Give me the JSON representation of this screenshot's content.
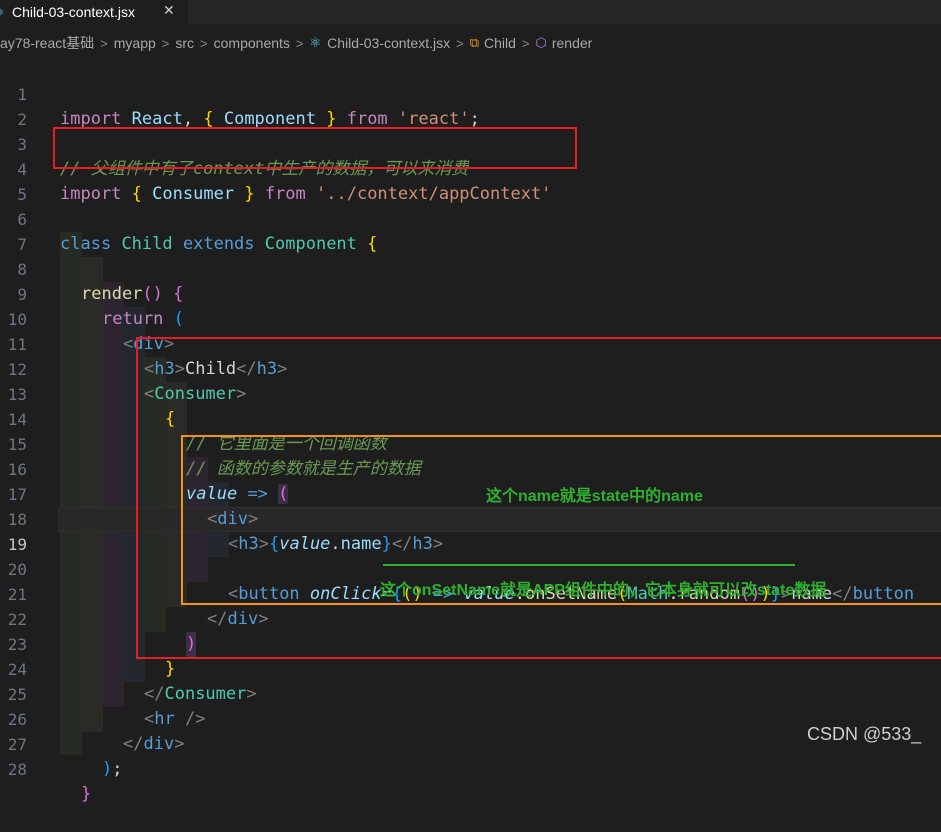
{
  "tab": {
    "icon": "react-icon",
    "title": "Child-03-context.jsx",
    "close": "✕"
  },
  "breadcrumb": {
    "items": [
      "ay78-react基础",
      "myapp",
      "src",
      "components"
    ],
    "file": "Child-03-context.jsx",
    "class_name": "Child",
    "method_name": "render"
  },
  "editor": {
    "line_numbers": [
      "1",
      "2",
      "3",
      "4",
      "5",
      "6",
      "7",
      "8",
      "9",
      "10",
      "11",
      "12",
      "13",
      "14",
      "15",
      "16",
      "17",
      "18",
      "19",
      "20",
      "21",
      "22",
      "23",
      "24",
      "25",
      "26",
      "27",
      "28"
    ],
    "active_line": "19",
    "code": {
      "l1": [
        "import",
        " ",
        "React",
        ", ",
        "{",
        " ",
        "Component",
        " ",
        "}",
        " ",
        "from",
        " ",
        "'react'",
        ";"
      ],
      "l3": "// 父组件中有了context中生产的数据，可以来消费",
      "l4": [
        "import",
        " ",
        "{",
        " ",
        "Consumer",
        " ",
        "}",
        " ",
        "from",
        " ",
        "'../context/appContext'"
      ],
      "l6": [
        "class",
        " ",
        "Child",
        " ",
        "extends",
        " ",
        "Component",
        " ",
        "{"
      ],
      "l8": [
        "render",
        "()",
        " ",
        "{"
      ],
      "l9": [
        "return",
        " ",
        "("
      ],
      "l10": [
        "<",
        "div",
        ">"
      ],
      "l11": [
        "<",
        "h3",
        ">",
        "Child",
        "</",
        "h3",
        ">"
      ],
      "l12": [
        "<",
        "Consumer",
        ">"
      ],
      "l13": "{",
      "l14": "// 它里面是一个回调函数",
      "l15": "// 函数的参数就是生产的数据",
      "l16": [
        "value",
        " ",
        "=>",
        " ",
        "("
      ],
      "l17": [
        "<",
        "div",
        ">"
      ],
      "l18": [
        "<",
        "h3",
        ">",
        "{",
        "value",
        ".",
        "name",
        "}",
        "</",
        "h3",
        ">"
      ],
      "l20": [
        "<",
        "button",
        " ",
        "onClick",
        "=",
        "{",
        "()",
        " ",
        "=>",
        " ",
        "value",
        ".",
        "onSetName",
        "(",
        "Math",
        ".",
        "random",
        "()",
        ")",
        "}",
        ">",
        "name",
        "</",
        "button"
      ],
      "l21": [
        "</",
        "div",
        ">"
      ],
      "l22": ")",
      "l23": "}",
      "l24": [
        "</",
        "Consumer",
        ">"
      ],
      "l25": [
        "<",
        "hr",
        " />"
      ],
      "l26": [
        "</",
        "div",
        ">"
      ],
      "l27": [
        ")",
        ";"
      ],
      "l28": "}"
    }
  },
  "annotations": {
    "note1": "这个name就是state中的name",
    "note2": "这个onSetName就是APP组件中的，它本身就可以改state数据",
    "box_color_red": "#e51f24",
    "box_color_orange": "#f0921b",
    "note_color": "#2fb12f"
  },
  "watermark": "CSDN @533_"
}
